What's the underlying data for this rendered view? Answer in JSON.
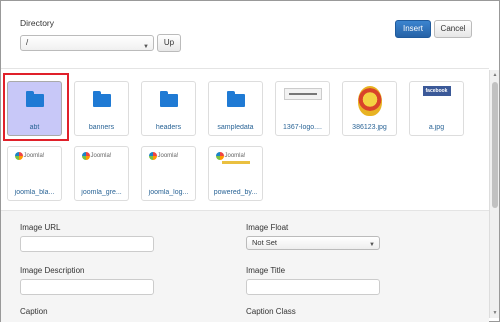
{
  "toolbar": {
    "directory_label": "Directory",
    "directory_value": "/",
    "up_label": "Up",
    "insert_label": "Insert",
    "cancel_label": "Cancel"
  },
  "folders": [
    {
      "name": "abt",
      "selected": true
    },
    {
      "name": "banners"
    },
    {
      "name": "headers"
    },
    {
      "name": "sampledata"
    }
  ],
  "images_row1": [
    {
      "name": "1367-logo....",
      "thumb": "banner"
    },
    {
      "name": "386123.jpg",
      "thumb": "seal"
    },
    {
      "name": "a.jpg",
      "thumb": "facebook",
      "thumb_text": "facebook"
    }
  ],
  "images_row2": [
    {
      "name": "joomla_bla...",
      "thumb_text": "Joomla!"
    },
    {
      "name": "joomla_gre...",
      "thumb_text": "Joomla!"
    },
    {
      "name": "joomla_log...",
      "thumb_text": "Joomla!"
    },
    {
      "name": "powered_by...",
      "thumb_text": "Joomla!"
    }
  ],
  "properties": {
    "image_url_label": "Image URL",
    "image_url_value": "",
    "image_float_label": "Image Float",
    "image_float_value": "Not Set",
    "image_description_label": "Image Description",
    "image_description_value": "",
    "image_title_label": "Image Title",
    "image_title_value": "",
    "caption_label": "Caption",
    "caption_class_label": "Caption Class"
  },
  "colors": {
    "primary": "#2662a6",
    "folder": "#1f7ad4",
    "selection_outline": "#e0202a",
    "selected_tile": "#c8c8f8"
  }
}
